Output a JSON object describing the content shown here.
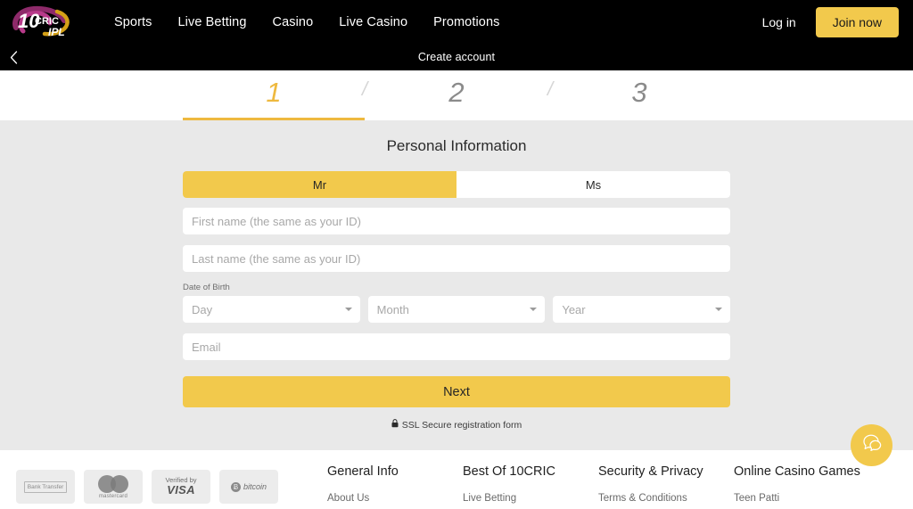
{
  "header": {
    "logo_alt": "10CRIC IPL",
    "logo_main": "10CRIC",
    "logo_sub": "IPL",
    "nav": [
      {
        "label": "Sports"
      },
      {
        "label": "Live Betting"
      },
      {
        "label": "Casino"
      },
      {
        "label": "Live Casino"
      },
      {
        "label": "Promotions"
      }
    ],
    "login_label": "Log in",
    "join_label": "Join now",
    "accent_color": "#f2c94c"
  },
  "subbar": {
    "title": "Create account",
    "back_icon": "chevron-left-icon"
  },
  "stepper": {
    "steps": [
      {
        "number": "1",
        "active": true
      },
      {
        "number": "2",
        "active": false
      },
      {
        "number": "3",
        "active": false
      }
    ],
    "separator": "/",
    "active_color": "#eeb93f",
    "inactive_color": "#8b8b8b"
  },
  "form": {
    "title": "Personal Information",
    "salutation": {
      "options": [
        {
          "label": "Mr",
          "selected": true
        },
        {
          "label": "Ms",
          "selected": false
        }
      ]
    },
    "first_name": {
      "value": "",
      "placeholder": "First name (the same as your ID)"
    },
    "last_name": {
      "value": "",
      "placeholder": "Last name (the same as your ID)"
    },
    "dob": {
      "label": "Date of Birth",
      "day": {
        "value": "Day"
      },
      "month": {
        "value": "Month"
      },
      "year": {
        "value": "Year"
      }
    },
    "email": {
      "value": "",
      "placeholder": "Email"
    },
    "next_label": "Next",
    "ssl_note": "SSL Secure registration form",
    "ssl_icon": "lock-icon",
    "background_color": "#e9e9e9"
  },
  "footer": {
    "payment_badges": [
      {
        "name": "bank-transfer",
        "label": "Bank Transfer"
      },
      {
        "name": "mastercard",
        "label": "mastercard"
      },
      {
        "name": "verified-by-visa",
        "label_top": "Verified by",
        "label_main": "VISA"
      },
      {
        "name": "bitcoin",
        "label": "bitcoin",
        "symbol": "Ƀ"
      }
    ],
    "columns": [
      {
        "title": "General Info",
        "links": [
          {
            "label": "About Us"
          }
        ]
      },
      {
        "title": "Best Of 10CRIC",
        "links": [
          {
            "label": "Live Betting"
          }
        ]
      },
      {
        "title": "Security & Privacy",
        "links": [
          {
            "label": "Terms & Conditions"
          }
        ]
      },
      {
        "title": "Online Casino Games",
        "links": [
          {
            "label": "Teen Patti"
          }
        ]
      }
    ]
  },
  "chat": {
    "icon": "chat-bubbles-icon",
    "color": "#f2c94c"
  }
}
